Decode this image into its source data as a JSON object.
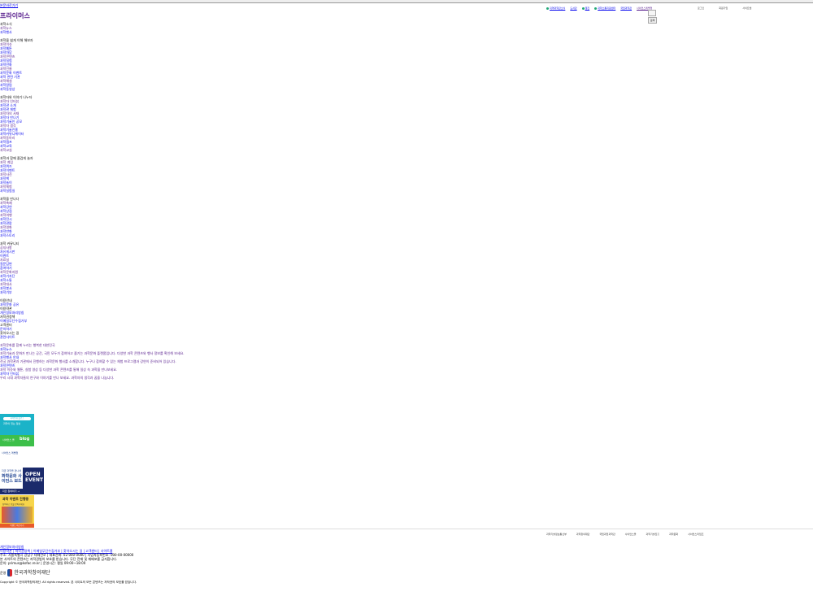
{
  "skip_link": "본문바로가기",
  "logo": "프라이머스",
  "toplinks": [
    {
      "label": "지역과학관소식"
    },
    {
      "label": "도서관"
    },
    {
      "label": "웹진"
    },
    {
      "label": "과학소통지원센터"
    },
    {
      "label": "국립과학관"
    },
    {
      "label": "사이언스레벨업"
    }
  ],
  "search_button": "검색",
  "userlinks": [
    "로그인",
    "회원가입",
    "사이트맵"
  ],
  "nav_sections": [
    {
      "heading": "과학소식",
      "items": [
        "과학뉴스",
        "과학행사"
      ]
    },
    {
      "heading": "과학을 쉽게 이해 해보자",
      "items": [
        "과학이슈",
        "과학웹툰",
        "과학마당",
        "과학콘텐츠",
        "과학실험",
        "과학만화",
        "과학인물",
        "과학문화 이벤트",
        "과학 관련 기관",
        "과학해설",
        "과학칼럼",
        "과학동영상"
      ]
    },
    {
      "heading": "과학자와 이야기 나누자",
      "items": [
        "과학자 인터뷰",
        "과학관 소개",
        "과학관 체험",
        "과학자의 서재",
        "과학자 만나기",
        "과학기술인 공모",
        "과학자 생각",
        "과학기술진흥",
        "과학커뮤니케이터",
        "과학동아리",
        "과학캠프",
        "과학교육",
        "과학교실"
      ]
    },
    {
      "heading": "과학과 함께 즐겁게 놀자",
      "items": [
        "과학 게임",
        "과학퀴즈",
        "과학이벤트",
        "과학사진",
        "과학책",
        "과학놀이",
        "과학체험",
        "과학실험실"
      ]
    },
    {
      "heading": "과학을 만나다",
      "items": [
        "과학축제",
        "과학강연",
        "과학상점",
        "과학여행",
        "과학전시",
        "과학관람",
        "과학영화",
        "과학만화",
        "과학스토리"
      ]
    },
    {
      "heading": "과학 커뮤니티",
      "items": [
        "공지사항",
        "자유게시판",
        "이벤트",
        "자료실",
        "질문답변",
        "참여하기",
        "과학문화지원",
        "과학기자단",
        "과학소통",
        "과학대사",
        "과학봉사",
        "과학기부"
      ]
    }
  ],
  "misc_lines": [
    "이용안내",
    "과학문화 공유",
    "이용약관",
    "개인정보처리방침",
    "저작권정책",
    "이메일무단수집거부",
    "고객센터",
    "문의하기",
    "찾아오시는 길",
    "관련사이트"
  ],
  "article_lines": [
    "과학문화를 함께 누리는 행복한 대한민국",
    "과학뉴스",
    "과학기술과 문화가 만나는 공간, 국민 모두가 참여하고 즐기는 과학문화 플랫폼입니다. 다양한 과학 콘텐츠와 행사 정보를 확인해 보세요.",
    "과학행사 안내",
    "전국 과학관과 기관에서 진행하는 과학문화 행사를 소개합니다. 누구나 참여할 수 있는 체험 프로그램과 강연이 준비되어 있습니다.",
    "과학콘텐츠",
    "과학 이슈와 웹툰, 실험 영상 등 다양한 과학 콘텐츠를 통해 일상 속 과학을 만나보세요.",
    "과학자 인터뷰",
    "우리 시대 과학자들의 연구와 이야기를 만나 보세요. 과학자의 생각과 꿈을 나눕니다."
  ],
  "banners": {
    "b1_title": "과학문화 블로그",
    "b1_sub": "과학이 있는 일상",
    "b2_sub": "사이언스 올",
    "b2_blog": "blog",
    "b3_top": "사이언스 레벨업",
    "b3_t1": "지금 과학을 만나세요",
    "b3_t2": "과학문화 사이언스 보드",
    "b3_open": "OPEN EVENT",
    "b3_bar": "지금 참여하기 →",
    "b4_title": "과학 이벤트 진행중",
    "b4_sub": "참여하고 선물 받아가세요",
    "b4_foot": "이벤트 바로가기"
  },
  "partners": [
    "과학기술정보통신부",
    "과학창의재단",
    "국립과천과학관",
    "사이언스올",
    "과학기술진흥",
    "과학문화",
    "사이언스타임즈"
  ],
  "footer_lines": [
    "개인정보처리방침",
    "이용약관 | 저작권정책 | 이메일무단수집거부 | 찾아오시는 길 | 고객센터 | 사이트맵",
    "주소: 서울특별시 강남구 테헤란로 | 대표전화: 02-000-0000 | 사업자등록번호: 000-00-00000",
    "본 사이트의 콘텐츠는 저작권법의 보호를 받습니다. 무단 전재 및 재배포를 금지합니다.",
    "문의: primus@kofac.re.kr | 운영시간: 평일 09:00~18:00"
  ],
  "operator_label": "운영",
  "org_name": "한국과학창의재단",
  "copyright": "Copyright © 한국과학창의재단. All rights reserved. 본 사이트의 모든 콘텐츠는 저작권의 보호를 받습니다."
}
